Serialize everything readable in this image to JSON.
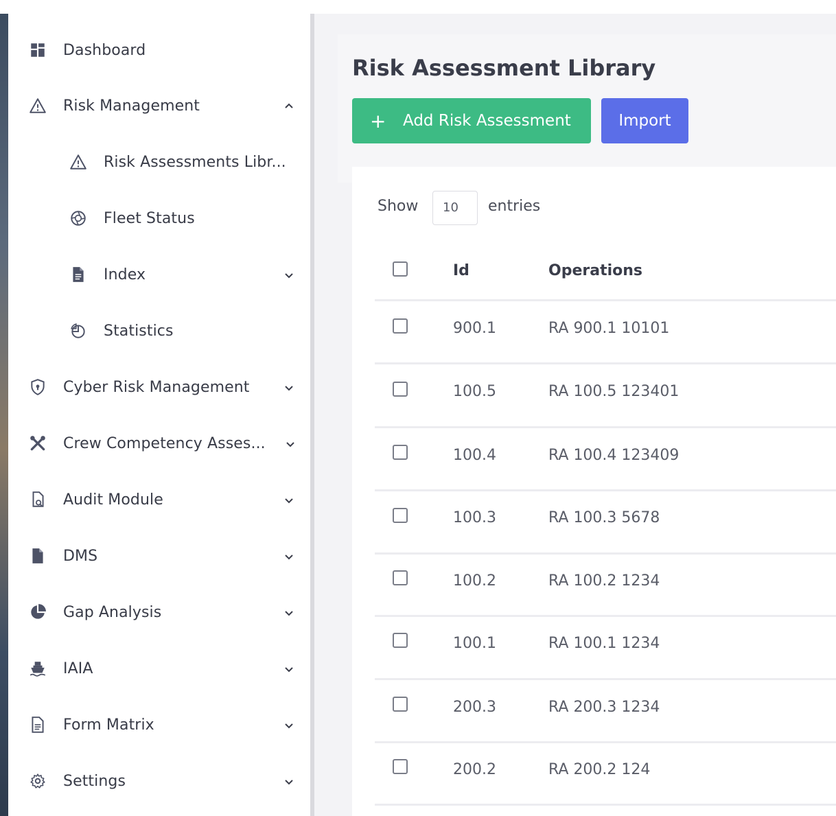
{
  "sidebar": {
    "items": [
      {
        "label": "Dashboard",
        "icon": "dashboard-grid-icon"
      },
      {
        "label": "Risk Management",
        "icon": "warning-triangle-icon",
        "expanded": true
      },
      {
        "label": "Risk Assessments Libr...",
        "icon": "warning-triangle-icon",
        "sub": true
      },
      {
        "label": "Fleet Status",
        "icon": "aperture-icon",
        "sub": true
      },
      {
        "label": "Index",
        "icon": "file-icon",
        "sub": true
      },
      {
        "label": "Statistics",
        "icon": "pie-outline-icon",
        "sub": true
      },
      {
        "label": "Cyber Risk Management",
        "icon": "shield-lock-icon"
      },
      {
        "label": "Crew Competency Asses...",
        "icon": "tools-icon"
      },
      {
        "label": "Audit Module",
        "icon": "file-search-icon"
      },
      {
        "label": "DMS",
        "icon": "document-icon"
      },
      {
        "label": "Gap Analysis",
        "icon": "pie-chart-icon"
      },
      {
        "label": "IAIA",
        "icon": "ship-icon"
      },
      {
        "label": "Form Matrix",
        "icon": "form-icon"
      },
      {
        "label": "Settings",
        "icon": "gear-icon"
      }
    ]
  },
  "main": {
    "title": "Risk Assessment Library",
    "add_button": {
      "icon": "+",
      "label": "Add Risk Assessment"
    },
    "import_button": "Import",
    "show_label": "Show",
    "entries_value": "10",
    "entries_label": "entries",
    "columns": [
      "Id",
      "Operations"
    ],
    "rows": [
      {
        "id": "900.1",
        "op": "RA 900.1 10101"
      },
      {
        "id": "100.5",
        "op": "RA 100.5 123401"
      },
      {
        "id": "100.4",
        "op": "RA 100.4 123409"
      },
      {
        "id": "100.3",
        "op": "RA 100.3 5678"
      },
      {
        "id": "100.2",
        "op": "RA 100.2 1234"
      },
      {
        "id": "100.1",
        "op": "RA 100.1 1234"
      },
      {
        "id": "200.3",
        "op": "RA 200.3 1234"
      },
      {
        "id": "200.2",
        "op": "RA 200.2 124"
      }
    ]
  },
  "colors": {
    "accent_green": "#3dbb84",
    "accent_blue": "#5b6ee8",
    "icon_gray": "#4d5266"
  }
}
